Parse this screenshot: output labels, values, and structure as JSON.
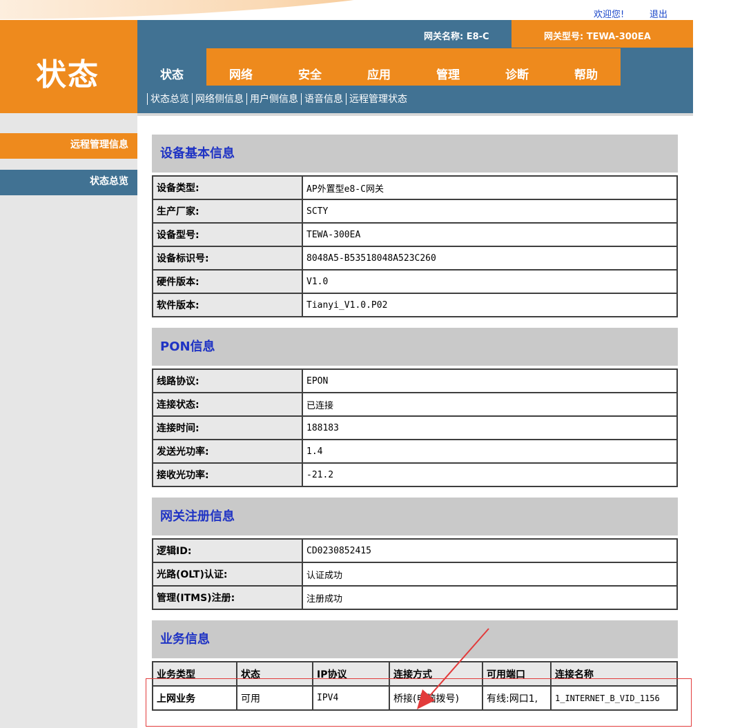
{
  "top": {
    "welcome": "欢迎您!",
    "logout": "退出"
  },
  "header": {
    "page_title": "状态",
    "gateway_name_label": "网关名称:",
    "gateway_name": "E8-C",
    "gateway_model_label": "网关型号:",
    "gateway_model": "TEWA-300EA"
  },
  "tabs": [
    "状态",
    "网络",
    "安全",
    "应用",
    "管理",
    "诊断",
    "帮助"
  ],
  "subnav": [
    "状态总览",
    "网络侧信息",
    "用户侧信息",
    "语音信息",
    "远程管理状态"
  ],
  "sidebar": {
    "items": [
      "远程管理信息",
      "状态总览"
    ]
  },
  "device": {
    "title": "设备基本信息",
    "rows": [
      {
        "label": "设备类型:",
        "value": "AP外置型e8-C网关"
      },
      {
        "label": "生产厂家:",
        "value": "SCTY"
      },
      {
        "label": "设备型号:",
        "value": "TEWA-300EA"
      },
      {
        "label": "设备标识号:",
        "value": "8048A5-B53518048A523C260"
      },
      {
        "label": "硬件版本:",
        "value": "V1.0"
      },
      {
        "label": "软件版本:",
        "value": "Tianyi_V1.0.P02"
      }
    ]
  },
  "pon": {
    "title": "PON信息",
    "rows": [
      {
        "label": "线路协议:",
        "value": "EPON"
      },
      {
        "label": "连接状态:",
        "value": "已连接"
      },
      {
        "label": "连接时间:",
        "value": "188183"
      },
      {
        "label": "发送光功率:",
        "value": "1.4"
      },
      {
        "label": "接收光功率:",
        "value": "-21.2"
      }
    ]
  },
  "registration": {
    "title": "网关注册信息",
    "rows": [
      {
        "label": "逻辑ID:",
        "value": "CD0230852415"
      },
      {
        "label": "光路(OLT)认证:",
        "value": "认证成功"
      },
      {
        "label": "管理(ITMS)注册:",
        "value": "注册成功"
      }
    ]
  },
  "service": {
    "title": "业务信息",
    "headers": [
      "业务类型",
      "状态",
      "IP协议",
      "连接方式",
      "可用端口",
      "连接名称"
    ],
    "rows": [
      [
        "上网业务",
        "可用",
        "IPV4",
        "桥接(电脑拨号)",
        "有线:网口1,",
        "1_INTERNET_B_VID_1156"
      ]
    ]
  },
  "colors": {
    "orange": "#ee8a1d",
    "blue": "#417293",
    "title_blue": "#1f33c4",
    "annotation_red": "#e23a3a"
  }
}
